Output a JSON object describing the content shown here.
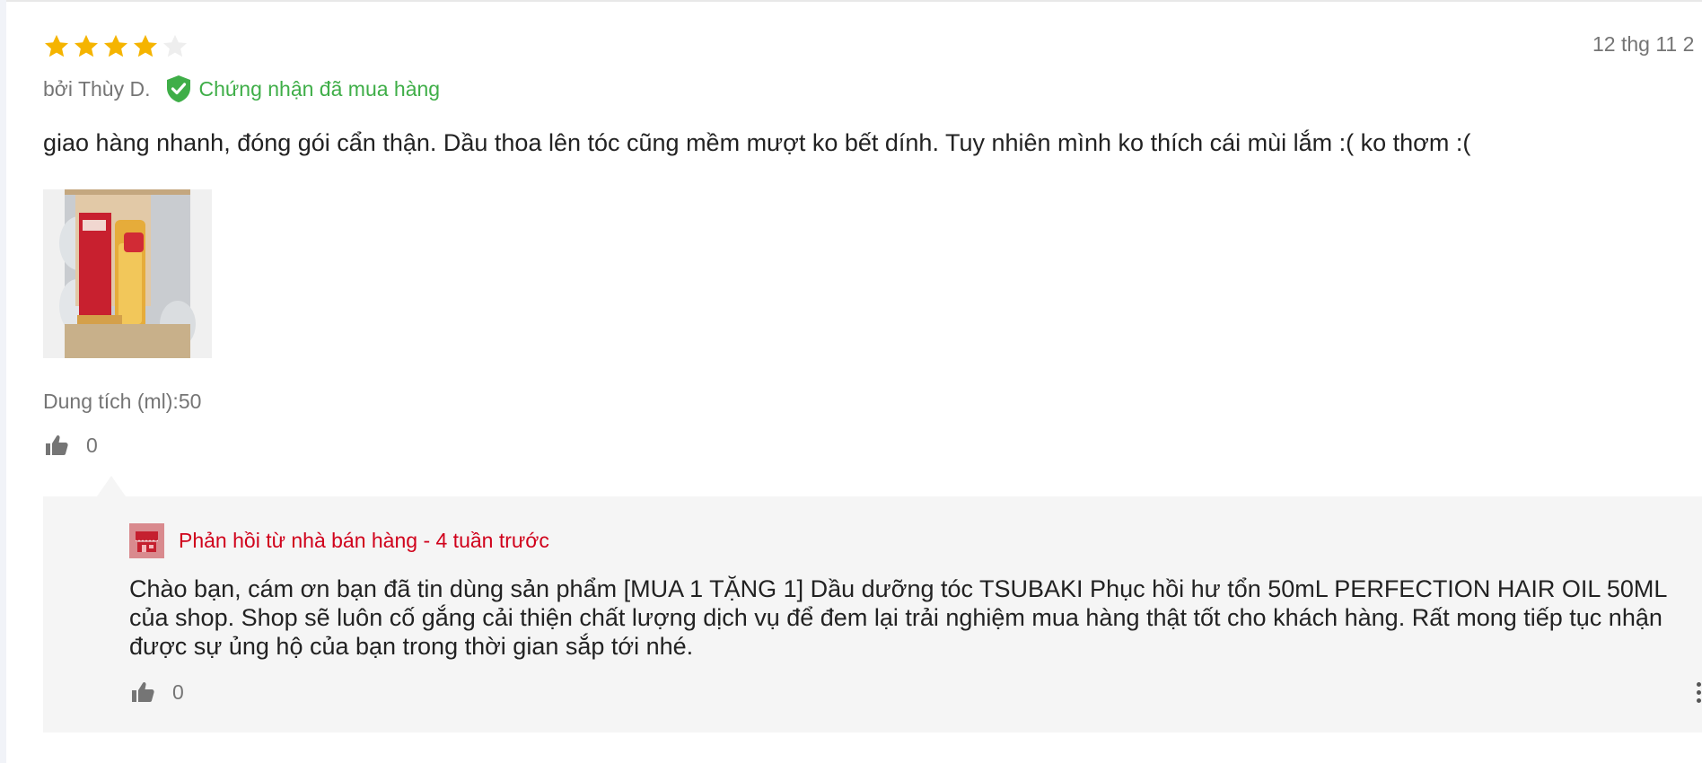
{
  "review": {
    "rating": 4,
    "max_rating": 5,
    "date": "12 thg 11 2",
    "author": "bởi Thùy D.",
    "verified_label": "Chứng nhận đã mua hàng",
    "text": "giao hàng nhanh, đóng gói cẩn thận. Dầu thoa lên tóc cũng mềm mượt ko bết dính. Tuy nhiên mình ko thích cái mùi lắm :( ko thơm :(",
    "variant": "Dung tích (ml):50",
    "likes": "0"
  },
  "reply": {
    "header": "Phản hồi từ nhà bán hàng - 4 tuần trước",
    "text": "Chào bạn, cám ơn bạn đã tin dùng sản phẩm [MUA 1 TẶNG 1] Dầu dưỡng tóc TSUBAKI Phục hồi hư tổn 50mL PERFECTION HAIR OIL 50ML của shop. Shop sẽ luôn cố gắng cải thiện chất lượng dịch vụ để đem lại trải nghiệm mua hàng thật tốt cho khách hàng. Rất mong tiếp tục nhận được sự ủng hộ của bạn trong thời gian sắp tới nhé.",
    "likes": "0"
  },
  "icons": {
    "star": "star-icon",
    "verified": "verified-shield-check-icon",
    "thumbs_up": "thumbs-up-icon",
    "shop": "shop-store-icon",
    "more": "more-vertical-icon"
  },
  "colors": {
    "star_filled": "#f5b400",
    "star_empty": "#eeeeee",
    "verified": "#3fae48",
    "seller_reply": "#d0011b",
    "reply_bg": "#f5f5f5",
    "muted_text": "#757575"
  }
}
